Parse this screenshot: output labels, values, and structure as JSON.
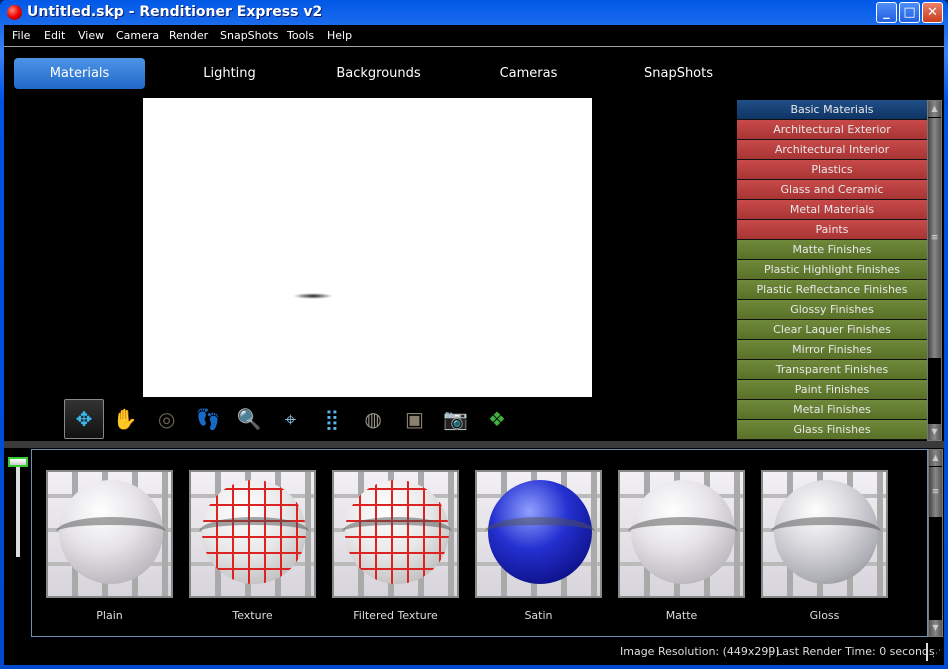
{
  "window": {
    "title": "Untitled.skp - Renditioner Express v2",
    "minimize": "_",
    "maximize": "□",
    "close": "✕"
  },
  "menu": [
    "File",
    "Edit",
    "View",
    "Camera",
    "Render",
    "SnapShots",
    "Tools",
    "Help"
  ],
  "tabs": [
    "Materials",
    "Lighting",
    "Backgrounds",
    "Cameras",
    "SnapShots"
  ],
  "active_tab": "Materials",
  "toolbar": [
    {
      "icon": "orbit-icon",
      "glyph": "✥",
      "color": "#3ab8f0"
    },
    {
      "icon": "pan-hand-icon",
      "glyph": "✋",
      "color": "#6a6355"
    },
    {
      "icon": "zoom-target-icon",
      "glyph": "◎",
      "color": "#6a6355"
    },
    {
      "icon": "walk-footprints-icon",
      "glyph": "👣",
      "color": "#6a6355"
    },
    {
      "icon": "magnifier-icon",
      "glyph": "🔍",
      "color": "#6a6355"
    },
    {
      "icon": "zoom-extents-icon",
      "glyph": "⌖",
      "color": "#8ab8d8"
    },
    {
      "icon": "grid-dots-icon",
      "glyph": "⣿",
      "color": "#5ab8f0"
    },
    {
      "icon": "disc-icon",
      "glyph": "◍",
      "color": "#9a958a"
    },
    {
      "icon": "frame-icon",
      "glyph": "▣",
      "color": "#8a8070"
    },
    {
      "icon": "camera-icon",
      "glyph": "📷",
      "color": "#e03030"
    },
    {
      "icon": "tiles-icon",
      "glyph": "❖",
      "color": "#40b040"
    }
  ],
  "materials": [
    {
      "label": "Basic Materials",
      "color": "blue"
    },
    {
      "label": "Architectural Exterior",
      "color": "red"
    },
    {
      "label": "Architectural Interior",
      "color": "red"
    },
    {
      "label": "Plastics",
      "color": "red"
    },
    {
      "label": "Glass and Ceramic",
      "color": "red"
    },
    {
      "label": "Metal Materials",
      "color": "red"
    },
    {
      "label": "Paints",
      "color": "red"
    },
    {
      "label": "Matte Finishes",
      "color": "green"
    },
    {
      "label": "Plastic Highlight Finishes",
      "color": "green"
    },
    {
      "label": "Plastic Reflectance Finishes",
      "color": "green"
    },
    {
      "label": "Glossy Finishes",
      "color": "green"
    },
    {
      "label": "Clear Laquer Finishes",
      "color": "green"
    },
    {
      "label": "Mirror Finishes",
      "color": "green"
    },
    {
      "label": "Transparent Finishes",
      "color": "green"
    },
    {
      "label": "Paint Finishes",
      "color": "green"
    },
    {
      "label": "Metal Finishes",
      "color": "green"
    },
    {
      "label": "Glass Finishes",
      "color": "green"
    }
  ],
  "swatches": [
    {
      "label": "Plain",
      "style": "plain"
    },
    {
      "label": "Texture",
      "style": "texture"
    },
    {
      "label": "Filtered Texture",
      "style": "texture"
    },
    {
      "label": "Satin",
      "style": "satin"
    },
    {
      "label": "Matte",
      "style": "plain"
    },
    {
      "label": "Gloss",
      "style": "gloss"
    }
  ],
  "status": {
    "resolution": "Image Resolution: (449x299)",
    "separator": "|",
    "render_time": "Last Render Time: 0 seconds"
  }
}
